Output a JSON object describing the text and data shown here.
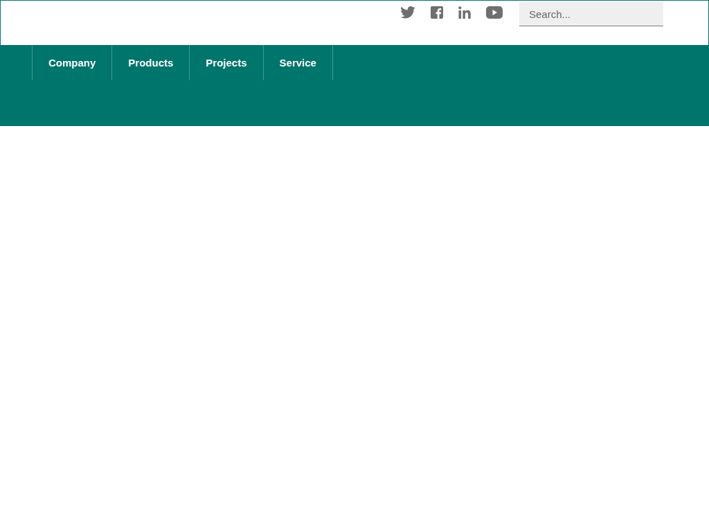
{
  "social_links": [
    {
      "kind": "bird"
    },
    {
      "kind": "square-f"
    },
    {
      "kind": "in"
    },
    {
      "kind": "play"
    }
  ],
  "search": {
    "placeholder": "Search..."
  },
  "nav": {
    "items": [
      {
        "label": "Company"
      },
      {
        "label": "Products"
      },
      {
        "label": "Projects"
      },
      {
        "label": "Service"
      }
    ]
  }
}
